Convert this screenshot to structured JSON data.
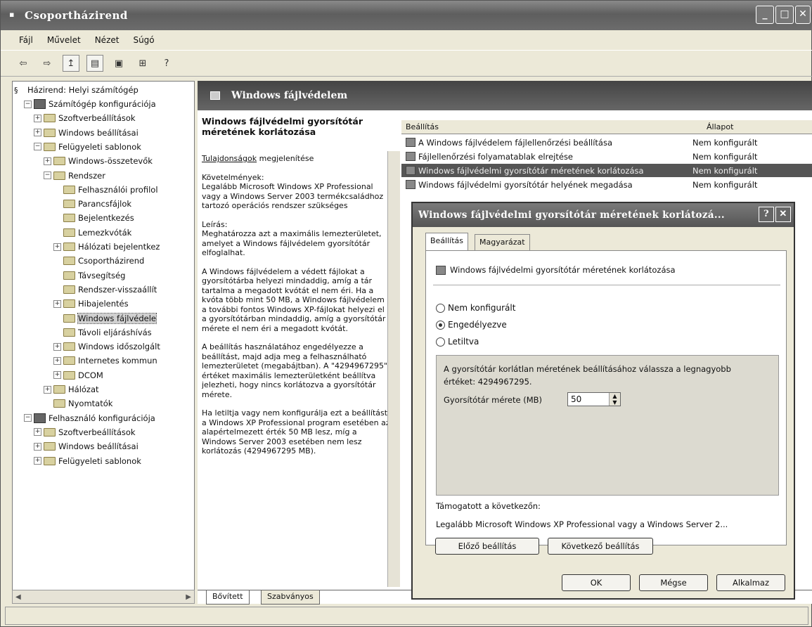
{
  "window": {
    "title": "Csoportházirend",
    "app_icon": "policy-icon"
  },
  "menu": [
    "Fájl",
    "Művelet",
    "Nézet",
    "Súgó"
  ],
  "tree": {
    "root": "Házirend: Helyi számítógép",
    "items": [
      {
        "label": "Számítógép konfigurációja",
        "level": 1,
        "exp": "−",
        "icon": "computer"
      },
      {
        "label": "Szoftverbeállítások",
        "level": 2,
        "exp": "+",
        "icon": "folder"
      },
      {
        "label": "Windows beállításai",
        "level": 2,
        "exp": "+",
        "icon": "folder"
      },
      {
        "label": "Felügyeleti sablonok",
        "level": 2,
        "exp": "−",
        "icon": "folder"
      },
      {
        "label": "Windows-összetevők",
        "level": 3,
        "exp": "+",
        "icon": "folder"
      },
      {
        "label": "Rendszer",
        "level": 3,
        "exp": "−",
        "icon": "folder"
      },
      {
        "label": "Felhasználói profilol",
        "level": 4,
        "exp": "",
        "icon": "folder"
      },
      {
        "label": "Parancsfájlok",
        "level": 4,
        "exp": "",
        "icon": "folder"
      },
      {
        "label": "Bejelentkezés",
        "level": 4,
        "exp": "",
        "icon": "folder"
      },
      {
        "label": "Lemezkvóták",
        "level": 4,
        "exp": "",
        "icon": "folder"
      },
      {
        "label": "Hálózati bejelentkez",
        "level": 4,
        "exp": "+",
        "icon": "folder"
      },
      {
        "label": "Csoportházirend",
        "level": 4,
        "exp": "",
        "icon": "folder"
      },
      {
        "label": "Távsegítség",
        "level": 4,
        "exp": "",
        "icon": "folder"
      },
      {
        "label": "Rendszer-visszaállít",
        "level": 4,
        "exp": "",
        "icon": "folder"
      },
      {
        "label": "Hibajelentés",
        "level": 4,
        "exp": "+",
        "icon": "folder"
      },
      {
        "label": "Windows fájlvédele",
        "level": 4,
        "exp": "",
        "icon": "folder",
        "selected": true
      },
      {
        "label": "Távoli eljáráshívás",
        "level": 4,
        "exp": "",
        "icon": "folder"
      },
      {
        "label": "Windows időszolgált",
        "level": 4,
        "exp": "+",
        "icon": "folder"
      },
      {
        "label": "Internetes kommun",
        "level": 4,
        "exp": "+",
        "icon": "folder"
      },
      {
        "label": "DCOM",
        "level": 4,
        "exp": "+",
        "icon": "folder"
      },
      {
        "label": "Hálózat",
        "level": 3,
        "exp": "+",
        "icon": "folder"
      },
      {
        "label": "Nyomtatók",
        "level": 3,
        "exp": "",
        "icon": "folder"
      },
      {
        "label": "Felhasználó konfigurációja",
        "level": 1,
        "exp": "−",
        "icon": "computer"
      },
      {
        "label": "Szoftverbeállítások",
        "level": 2,
        "exp": "+",
        "icon": "folder"
      },
      {
        "label": "Windows beállításai",
        "level": 2,
        "exp": "+",
        "icon": "folder"
      },
      {
        "label": "Felügyeleti sablonok",
        "level": 2,
        "exp": "+",
        "icon": "folder"
      }
    ]
  },
  "right": {
    "header": "Windows fájlvédelem",
    "desc": {
      "title": "Windows fájlvédelmi gyorsítótár méretének korlátozása",
      "props_link": "Tulajdonságok",
      "props_rest": " megjelenítése",
      "req": "Követelmények:\nLegalább Microsoft Windows XP Professional vagy a Windows Server 2003 termékcsaládhoz tartozó operációs rendszer szükséges",
      "d1": "Leírás:\nMeghatározza azt a maximális lemezterületet, amelyet a Windows fájlvédelem gyorsítótár elfoglalhat.",
      "d2": "A Windows fájlvédelem a védett fájlokat a gyorsítótárba helyezi mindaddig, amíg a tár tartalma a megadott kvótát el nem éri. Ha a kvóta több mint 50 MB, a Windows fájlvédelem a további fontos Windows XP-fájlokat helyezi el a gyorsítótárban mindaddig, amíg a gyorsítótár mérete el nem éri a megadott kvótát.",
      "d3": "A beállítás használatához engedélyezze a beállítást, majd adja meg a felhasználható lemezterületet (megabájtban). A \"4294967295\" értéket maximális lemezterületként beállítva jelezheti, hogy nincs korlátozva a gyorsítótár mérete.",
      "d4": "Ha letiltja vagy nem konfigurálja ezt a beállítást, a Windows XP Professional program esetében az alapértelmezett érték 50 MB lesz, míg a Windows Server 2003 esetében nem lesz korlátozás (4294967295 MB)."
    },
    "list": {
      "col_setting": "Beállítás",
      "col_state": "Állapot",
      "rows": [
        {
          "name": "A Windows fájlvédelem fájlellenőrzési beállítása",
          "state": "Nem konfigurált"
        },
        {
          "name": "Fájlellenőrzési folyamatablak elrejtése",
          "state": "Nem konfigurált"
        },
        {
          "name": "Windows fájlvédelmi gyorsítótár méretének korlátozása",
          "state": "Nem konfigurált",
          "selected": true
        },
        {
          "name": "Windows fájlvédelmi gyorsítótár helyének megadása",
          "state": "Nem konfigurált"
        }
      ]
    },
    "tabs": [
      "Bővített",
      "Szabványos"
    ]
  },
  "dialog": {
    "title": "Windows fájlvédelmi gyorsítótár méretének korlátozá...",
    "tabs": [
      "Beállítás",
      "Magyarázat"
    ],
    "setting": "Windows fájlvédelmi gyorsítótár méretének korlátozása",
    "radios": [
      "Nem konfigurált",
      "Engedélyezve",
      "Letiltva"
    ],
    "selected_radio": 1,
    "opt_text": "A gyorsítótár korlátlan méretének beállításához válassza a legnagyobb értéket: 4294967295.",
    "cache_label": "Gyorsítótár mérete (MB)",
    "cache_value": "50",
    "supported_label": "Támogatott a következőn:",
    "supported_value": "Legalább Microsoft Windows XP Professional vagy a Windows Server 2...",
    "prev": "Előző beállítás",
    "next": "Következő beállítás",
    "ok": "OK",
    "cancel": "Mégse",
    "apply": "Alkalmaz"
  }
}
